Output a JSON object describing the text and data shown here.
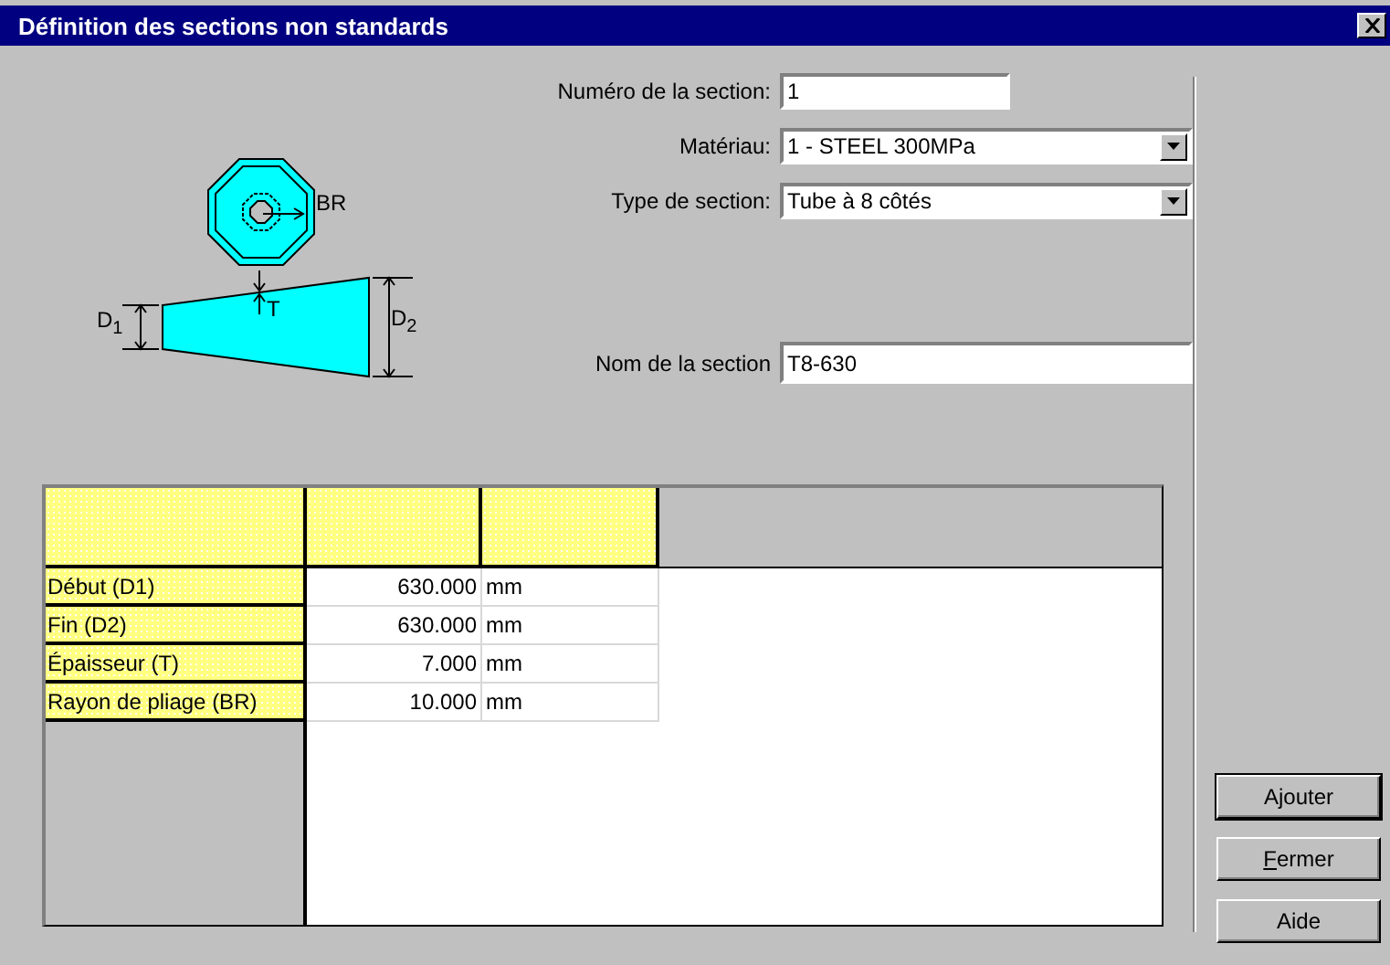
{
  "window": {
    "title": "Définition des sections non standards"
  },
  "diagram": {
    "labels": [
      {
        "kind": "br",
        "text": "BR"
      },
      {
        "kind": "t",
        "text": "T"
      },
      {
        "kind": "d1",
        "text": "D$_{1}$"
      },
      {
        "kind": "d2",
        "text": "D$_{2}$"
      }
    ]
  },
  "form": {
    "fields": [
      {
        "kind": "input",
        "label": "Numéro de la section:",
        "value": "1"
      },
      {
        "kind": "select",
        "label": "Matériau:",
        "value": "1 - STEEL 300MPa"
      },
      {
        "kind": "select",
        "label": "Type de section:",
        "value": "Tube à 8 côtés"
      },
      {
        "kind": "wide-input",
        "label": "Nom de la section",
        "value": "T8-630"
      }
    ]
  },
  "table": {
    "rows": [
      {
        "label": "Début (D1)",
        "value": "630.000",
        "unit": "mm"
      },
      {
        "label": "Fin (D2)",
        "value": "630.000",
        "unit": "mm"
      },
      {
        "label": "Épaisseur (T)",
        "value": "7.000",
        "unit": "mm"
      },
      {
        "label": "Rayon de pliage (BR)",
        "value": "10.000",
        "unit": "mm"
      }
    ]
  },
  "buttons": [
    {
      "label": "Ajouter",
      "default": true,
      "mnemonic": false
    },
    {
      "label": "Fermer",
      "default": false,
      "mnemonic": true
    },
    {
      "label": "Aide",
      "default": false,
      "mnemonic": false
    }
  ]
}
